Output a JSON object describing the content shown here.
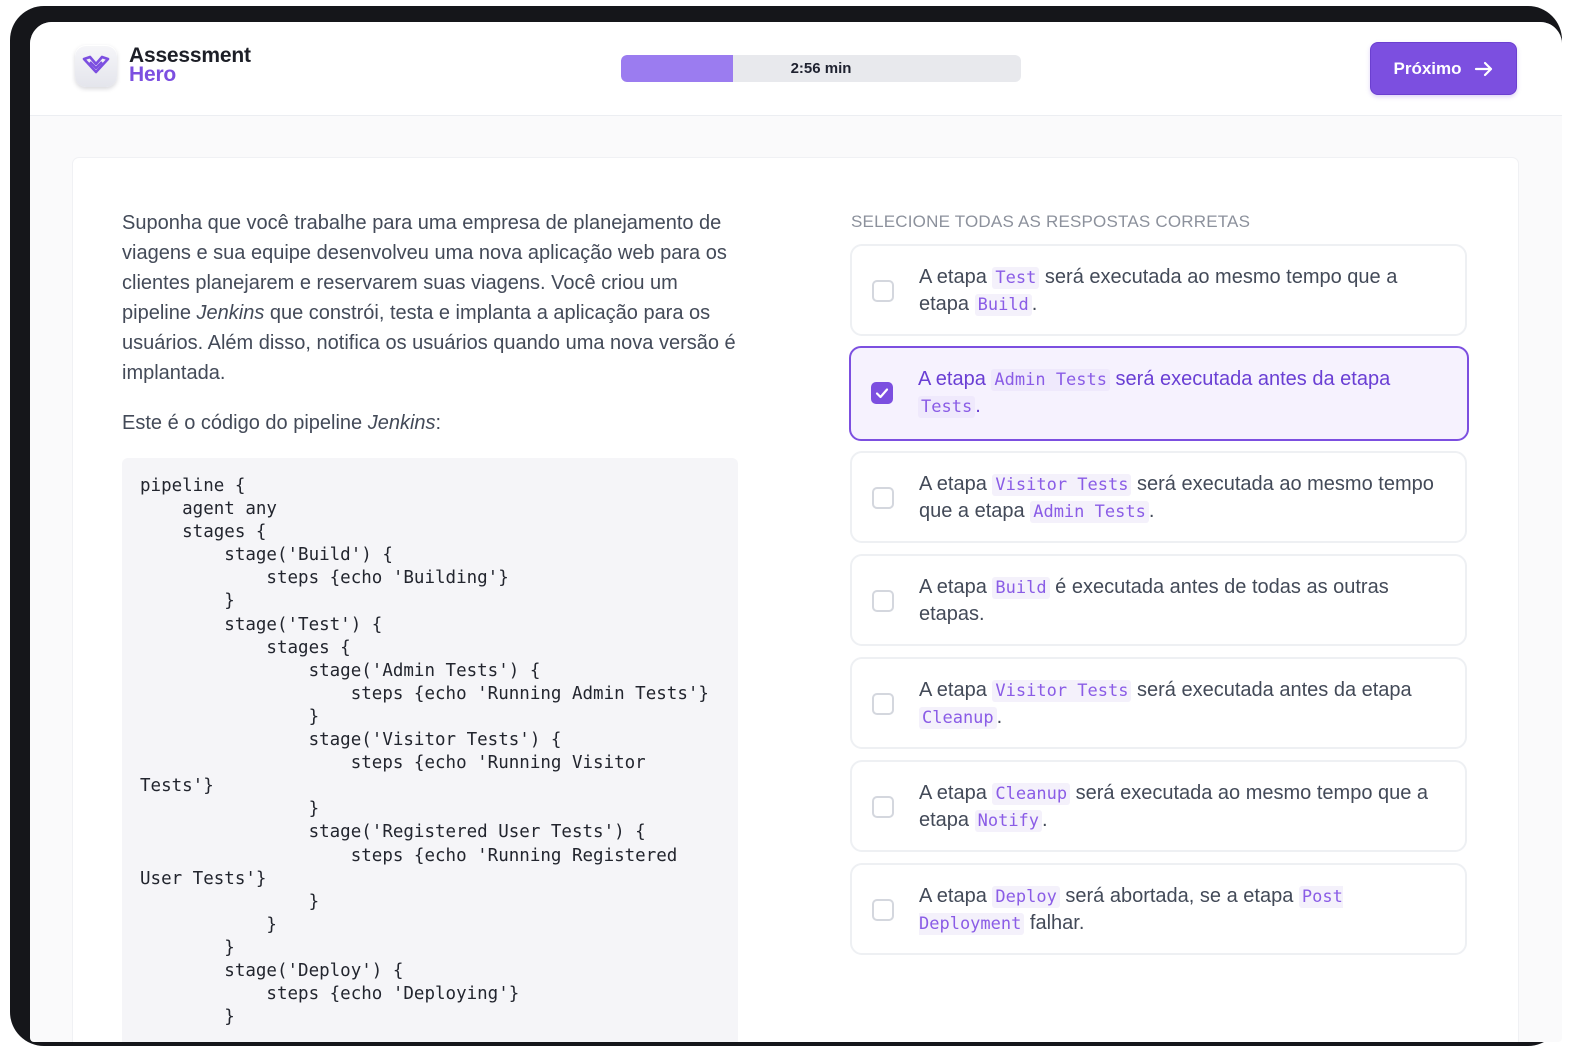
{
  "app": {
    "logo_line1": "Assessment",
    "logo_line2": "Hero"
  },
  "timer": {
    "label": "2:56 min",
    "progress_fraction": 0.28
  },
  "next_button": {
    "label": "Próximo"
  },
  "question": {
    "paragraph1_before": "Suponha que você trabalhe para uma empresa de planejamento de viagens e sua equipe desenvolveu uma nova aplicação web para os clientes planejarem e reservarem suas viagens. Você criou um pipeline ",
    "paragraph1_em": "Jenkins",
    "paragraph1_after": " que constrói, testa e implanta a aplicação para os usuários. Além disso, notifica os usuários quando uma nova versão é implantada.",
    "paragraph2_before": "Este é o código do pipeline ",
    "paragraph2_em": "Jenkins",
    "paragraph2_after": ":",
    "code": [
      "pipeline {",
      "    agent any",
      "    stages {",
      "        stage('Build') {",
      "            steps {echo 'Building'}",
      "        }",
      "        stage('Test') {",
      "            stages {",
      "                stage('Admin Tests') {",
      "                    steps {echo 'Running Admin Tests'}",
      "                }",
      "                stage('Visitor Tests') {",
      "                    steps {echo 'Running Visitor",
      "Tests'}",
      "                }",
      "                stage('Registered User Tests') {",
      "                    steps {echo 'Running Registered",
      "User Tests'}",
      "                }",
      "            }",
      "        }",
      "        stage('Deploy') {",
      "            steps {echo 'Deploying'}",
      "        }"
    ]
  },
  "answers": {
    "title": "SELECIONE TODAS AS RESPOSTAS CORRETAS",
    "options": [
      {
        "parts": [
          "A etapa ",
          {
            "code": "Test"
          },
          " será executada ao mesmo tempo que a etapa ",
          {
            "code": "Build"
          },
          "."
        ],
        "checked": false
      },
      {
        "parts": [
          "A etapa ",
          {
            "code": "Admin Tests"
          },
          " será executada antes da etapa ",
          {
            "code": "Tests"
          },
          "."
        ],
        "checked": true
      },
      {
        "parts": [
          "A etapa ",
          {
            "code": "Visitor Tests"
          },
          " será executada ao mesmo tempo que a etapa ",
          {
            "code": "Admin Tests"
          },
          "."
        ],
        "checked": false
      },
      {
        "parts": [
          "A etapa ",
          {
            "code": "Build"
          },
          " é executada antes de todas as outras etapas."
        ],
        "checked": false
      },
      {
        "parts": [
          "A etapa ",
          {
            "code": "Visitor Tests"
          },
          " será executada antes da etapa ",
          {
            "code": "Cleanup"
          },
          "."
        ],
        "checked": false
      },
      {
        "parts": [
          "A etapa ",
          {
            "code": "Cleanup"
          },
          " será executada ao mesmo tempo que a etapa ",
          {
            "code": "Notify"
          },
          "."
        ],
        "checked": false
      },
      {
        "parts": [
          "A etapa ",
          {
            "code": "Deploy"
          },
          " será abortada, se a etapa ",
          {
            "code": "Post Deployment"
          },
          " falhar."
        ],
        "checked": false
      }
    ]
  },
  "colors": {
    "accent": "#7c4fe0",
    "progress_fill": "#9b7cf0",
    "selected_bg": "#f6f2fe"
  }
}
